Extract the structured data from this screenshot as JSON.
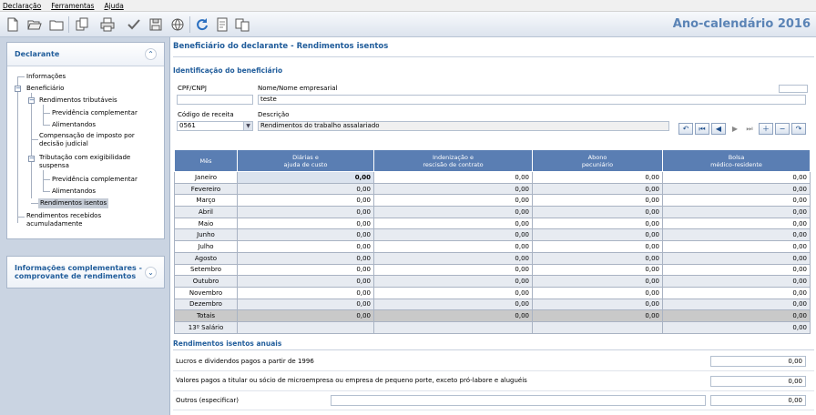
{
  "menu": {
    "items": [
      "Declaração",
      "Ferramentas",
      "Ajuda"
    ]
  },
  "toolbar": {
    "year_title": "Ano-calendário 2016"
  },
  "sidebar": {
    "panel1_title": "Declarante",
    "tree": {
      "informacoes": "Informações",
      "beneficiario": "Beneficiário",
      "rend_tributaveis": "Rendimentos tributáveis",
      "prev_comp_1": "Previdência complementar",
      "alimentandos_1": "Alimentandos",
      "compensacao": "Compensação de imposto por decisão judicial",
      "tributacao": "Tributação com exigibilidade suspensa",
      "prev_comp_2": "Previdência complementar",
      "alimentandos_2": "Alimentandos",
      "rend_isentos": "Rendimentos isentos",
      "rend_acumulado": "Rendimentos recebidos acumuladamente"
    },
    "panel2_title": "Informações complementares - comprovante de rendimentos"
  },
  "main": {
    "title": "Beneficiário do declarante - Rendimentos isentos",
    "ident_title": "Identificação do beneficiário",
    "cpf_label": "CPF/CNPJ",
    "cpf_value": "",
    "nome_label": "Nome/Nome empresarial",
    "nome_value": "teste",
    "codigo_label": "Código de receita",
    "codigo_value": "0561",
    "descricao_label": "Descrição",
    "descricao_value": "Rendimentos do trabalho assalariado"
  },
  "grid": {
    "headers": [
      "Mês",
      "Diárias e\najuda de custo",
      "Indenização e\nrescisão de contrato",
      "Abono\npecuniário",
      "Bolsa\nmédico-residente"
    ],
    "rows": [
      [
        "Janeiro",
        "0,00",
        "0,00",
        "0,00",
        "0,00"
      ],
      [
        "Fevereiro",
        "0,00",
        "0,00",
        "0,00",
        "0,00"
      ],
      [
        "Março",
        "0,00",
        "0,00",
        "0,00",
        "0,00"
      ],
      [
        "Abril",
        "0,00",
        "0,00",
        "0,00",
        "0,00"
      ],
      [
        "Maio",
        "0,00",
        "0,00",
        "0,00",
        "0,00"
      ],
      [
        "Junho",
        "0,00",
        "0,00",
        "0,00",
        "0,00"
      ],
      [
        "Julho",
        "0,00",
        "0,00",
        "0,00",
        "0,00"
      ],
      [
        "Agosto",
        "0,00",
        "0,00",
        "0,00",
        "0,00"
      ],
      [
        "Setembro",
        "0,00",
        "0,00",
        "0,00",
        "0,00"
      ],
      [
        "Outubro",
        "0,00",
        "0,00",
        "0,00",
        "0,00"
      ],
      [
        "Novembro",
        "0,00",
        "0,00",
        "0,00",
        "0,00"
      ],
      [
        "Dezembro",
        "0,00",
        "0,00",
        "0,00",
        "0,00"
      ],
      [
        "Totais",
        "0,00",
        "0,00",
        "0,00",
        "0,00"
      ],
      [
        "13º Salário",
        "",
        "",
        "",
        "0,00"
      ]
    ]
  },
  "anuais": {
    "title": "Rendimentos isentos anuais",
    "lucros_label": "Lucros e dividendos pagos a partir de 1996",
    "lucros_value": "0,00",
    "valores_label": "Valores pagos a titular ou sócio de microempresa ou empresa de pequeno porte, exceto pró-labore e aluguéis",
    "valores_value": "0,00",
    "outros_label": "Outros (especificar)",
    "outros_text": "",
    "outros_value": "0,00"
  }
}
